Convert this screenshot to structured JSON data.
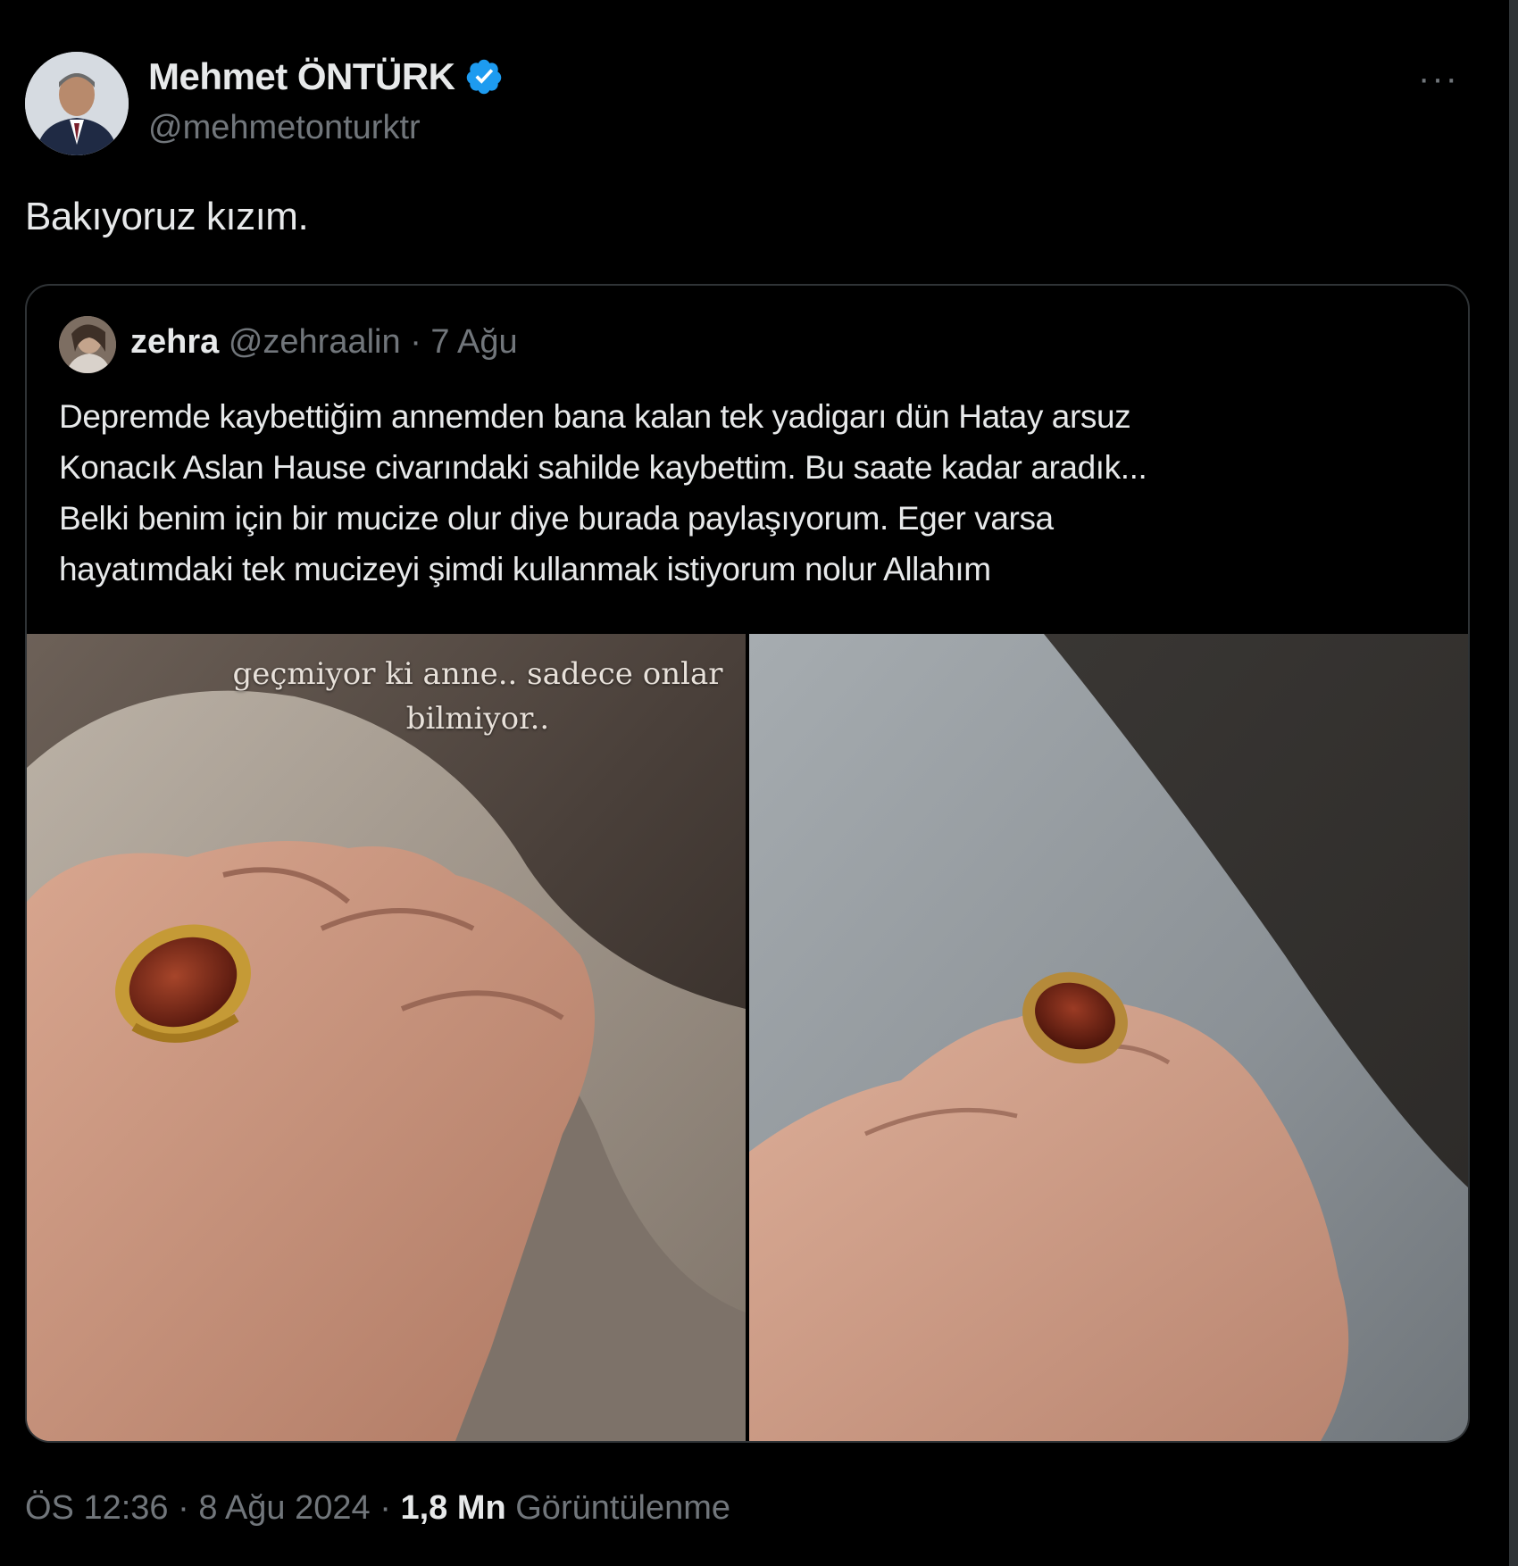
{
  "author": {
    "display_name": "Mehmet ÖNTÜRK",
    "handle": "@mehmetonturktr",
    "verified": true
  },
  "menu": {
    "more_icon": "more-horizontal-icon",
    "more_glyph": "···"
  },
  "tweet": {
    "text": "Bakıyoruz kızım."
  },
  "quote": {
    "author_name": "zehra",
    "author_handle": "@zehraalin",
    "separator": "·",
    "date": "7 Ağu",
    "text_lines": [
      "Depremde kaybettiğim annemden bana kalan tek yadigarı dün Hatay arsuz",
      "Konacık Aslan Hause civarındaki sahilde kaybettim. Bu saate kadar aradık...",
      "Belki benim için bir mucize olur diye burada paylaşıyorum. Eger varsa",
      "hayatımdaki tek mucizeyi şimdi kullanmak istiyorum nolur Allahım"
    ],
    "photo_caption_lines": [
      "geçmiyor ki  anne.. sadece onlar",
      "bilmiyor.."
    ]
  },
  "footer": {
    "time": "ÖS 12:36",
    "separator": "·",
    "date": "8 Ağu 2024",
    "views_count": "1,8 Mn",
    "views_label": "Görüntülenme"
  },
  "colors": {
    "background": "#000000",
    "text_primary": "#e7e9ea",
    "text_secondary": "#71767b",
    "border": "#2f3336",
    "verified_blue": "#1d9bf0"
  }
}
